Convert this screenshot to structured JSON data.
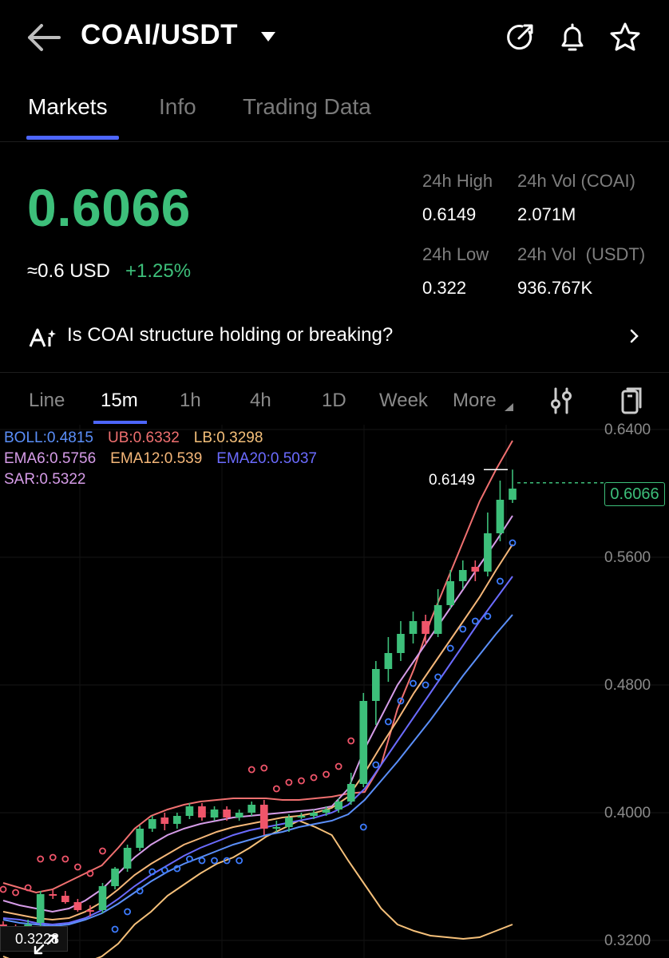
{
  "header": {
    "pair": "COAI/USDT",
    "icons": [
      "back-arrow-icon",
      "dropdown-caret-icon",
      "share-icon",
      "bell-icon",
      "star-icon"
    ]
  },
  "tabs": [
    "Markets",
    "Info",
    "Trading Data"
  ],
  "ticker": {
    "price": "0.6066",
    "usd_approx": "≈0.6 USD",
    "change": "+1.25%",
    "high_label": "24h High",
    "high_value": "0.6149",
    "vol_coin_label": "24h Vol (COAI)",
    "vol_coin_value": "2.071M",
    "low_label": "24h Low",
    "low_value": "0.322",
    "vol_usdt_label": "24h Vol  (USDT)",
    "vol_usdt_value": "936.767K"
  },
  "banner": {
    "text": "Is COAI structure holding or breaking?"
  },
  "intervals": [
    "Line",
    "15m",
    "1h",
    "4h",
    "1D",
    "Week",
    "More"
  ],
  "indicators": {
    "boll": "BOLL:0.4815",
    "ub": "UB:0.6332",
    "lb": "LB:0.3298",
    "ema6": "EMA6:0.5756",
    "ema12": "EMA12:0.539",
    "ema20": "EMA20:0.5037",
    "sar": "SAR:0.5322"
  },
  "colors": {
    "up": "#3dbf7a",
    "down": "#f0556a",
    "boll": "#5b8ff9",
    "ub": "#f07070",
    "lb": "#f5c07a",
    "ema6": "#d69ce8",
    "ema12": "#f5b779",
    "ema20": "#6b6bff",
    "sar": "#3d7cff",
    "accent": "#4d66ff"
  },
  "chart": {
    "high_marker": "0.6149",
    "current_price_tag": "0.6066",
    "low_marker": "0.3228",
    "axis_labels": [
      "0.6400",
      "0.5600",
      "0.4800",
      "0.4000",
      "0.3200"
    ]
  },
  "chart_data": {
    "type": "candlestick",
    "ylim": [
      0.3,
      0.645
    ],
    "y_ticks": [
      0.64,
      0.56,
      0.48,
      0.4,
      0.32
    ],
    "candles": [
      [
        0.33,
        0.327,
        0.332,
        0.325
      ],
      [
        0.327,
        0.324,
        0.33,
        0.322
      ],
      [
        0.325,
        0.33,
        0.333,
        0.323
      ],
      [
        0.331,
        0.349,
        0.351,
        0.329
      ],
      [
        0.349,
        0.348,
        0.352,
        0.346
      ],
      [
        0.348,
        0.344,
        0.351,
        0.343
      ],
      [
        0.344,
        0.339,
        0.346,
        0.338
      ],
      [
        0.339,
        0.338,
        0.342,
        0.335
      ],
      [
        0.339,
        0.354,
        0.356,
        0.337
      ],
      [
        0.354,
        0.365,
        0.366,
        0.352
      ],
      [
        0.365,
        0.378,
        0.38,
        0.363
      ],
      [
        0.378,
        0.39,
        0.392,
        0.376
      ],
      [
        0.39,
        0.396,
        0.398,
        0.388
      ],
      [
        0.397,
        0.393,
        0.4,
        0.389
      ],
      [
        0.393,
        0.398,
        0.4,
        0.39
      ],
      [
        0.398,
        0.404,
        0.406,
        0.396
      ],
      [
        0.404,
        0.397,
        0.406,
        0.395
      ],
      [
        0.397,
        0.402,
        0.404,
        0.395
      ],
      [
        0.402,
        0.397,
        0.404,
        0.395
      ],
      [
        0.397,
        0.4,
        0.402,
        0.395
      ],
      [
        0.4,
        0.405,
        0.407,
        0.398
      ],
      [
        0.405,
        0.39,
        0.408,
        0.386
      ],
      [
        0.39,
        0.391,
        0.395,
        0.388
      ],
      [
        0.391,
        0.397,
        0.399,
        0.388
      ],
      [
        0.397,
        0.398,
        0.4,
        0.396
      ],
      [
        0.398,
        0.4,
        0.402,
        0.396
      ],
      [
        0.4,
        0.402,
        0.404,
        0.398
      ],
      [
        0.402,
        0.407,
        0.409,
        0.4
      ],
      [
        0.407,
        0.418,
        0.425,
        0.405
      ],
      [
        0.418,
        0.47,
        0.475,
        0.416
      ],
      [
        0.47,
        0.49,
        0.495,
        0.455
      ],
      [
        0.49,
        0.5,
        0.51,
        0.482
      ],
      [
        0.5,
        0.512,
        0.52,
        0.495
      ],
      [
        0.512,
        0.52,
        0.526,
        0.506
      ],
      [
        0.52,
        0.512,
        0.524,
        0.505
      ],
      [
        0.512,
        0.53,
        0.54,
        0.51
      ],
      [
        0.53,
        0.545,
        0.552,
        0.528
      ],
      [
        0.545,
        0.552,
        0.558,
        0.54
      ],
      [
        0.554,
        0.551,
        0.558,
        0.545
      ],
      [
        0.551,
        0.575,
        0.588,
        0.548
      ],
      [
        0.575,
        0.596,
        0.608,
        0.57
      ],
      [
        0.596,
        0.603,
        0.6149,
        0.594
      ]
    ],
    "series": [
      {
        "name": "UB",
        "values": [
          0.356,
          0.353,
          0.35,
          0.352,
          0.357,
          0.362,
          0.367,
          0.378,
          0.39,
          0.398,
          0.402,
          0.405,
          0.407,
          0.408,
          0.409,
          0.409,
          0.409,
          0.408,
          0.408,
          0.409,
          0.41,
          0.412,
          0.413,
          0.43,
          0.465,
          0.49,
          0.52,
          0.545,
          0.57,
          0.595,
          0.615,
          0.633
        ]
      },
      {
        "name": "LB",
        "values": [
          0.31,
          0.306,
          0.303,
          0.302,
          0.303,
          0.306,
          0.31,
          0.318,
          0.33,
          0.338,
          0.348,
          0.355,
          0.362,
          0.368,
          0.372,
          0.378,
          0.385,
          0.39,
          0.395,
          0.391,
          0.386,
          0.37,
          0.355,
          0.34,
          0.33,
          0.326,
          0.323,
          0.322,
          0.321,
          0.322,
          0.326,
          0.33
        ]
      },
      {
        "name": "EMA6",
        "values": [
          0.345,
          0.342,
          0.34,
          0.338,
          0.34,
          0.345,
          0.352,
          0.362,
          0.372,
          0.38,
          0.386,
          0.39,
          0.393,
          0.395,
          0.397,
          0.398,
          0.399,
          0.4,
          0.401,
          0.402,
          0.404,
          0.415,
          0.44,
          0.46,
          0.48,
          0.495,
          0.51,
          0.525,
          0.54,
          0.555,
          0.57,
          0.586
        ]
      },
      {
        "name": "EMA12",
        "values": [
          0.338,
          0.336,
          0.334,
          0.333,
          0.334,
          0.338,
          0.344,
          0.352,
          0.361,
          0.368,
          0.374,
          0.38,
          0.384,
          0.388,
          0.391,
          0.393,
          0.395,
          0.397,
          0.398,
          0.4,
          0.403,
          0.41,
          0.425,
          0.442,
          0.458,
          0.475,
          0.49,
          0.505,
          0.52,
          0.535,
          0.552,
          0.568
        ]
      },
      {
        "name": "EMA20",
        "values": [
          0.334,
          0.333,
          0.331,
          0.33,
          0.331,
          0.334,
          0.339,
          0.346,
          0.354,
          0.361,
          0.367,
          0.373,
          0.378,
          0.382,
          0.386,
          0.389,
          0.391,
          0.393,
          0.395,
          0.397,
          0.4,
          0.405,
          0.415,
          0.43,
          0.445,
          0.46,
          0.475,
          0.49,
          0.505,
          0.52,
          0.534,
          0.548
        ]
      },
      {
        "name": "BOLL",
        "values": [
          0.333,
          0.331,
          0.33,
          0.329,
          0.33,
          0.333,
          0.337,
          0.343,
          0.35,
          0.357,
          0.363,
          0.368,
          0.372,
          0.376,
          0.38,
          0.383,
          0.386,
          0.388,
          0.391,
          0.393,
          0.395,
          0.399,
          0.408,
          0.42,
          0.432,
          0.445,
          0.458,
          0.472,
          0.486,
          0.499,
          0.512,
          0.524
        ]
      }
    ]
  }
}
